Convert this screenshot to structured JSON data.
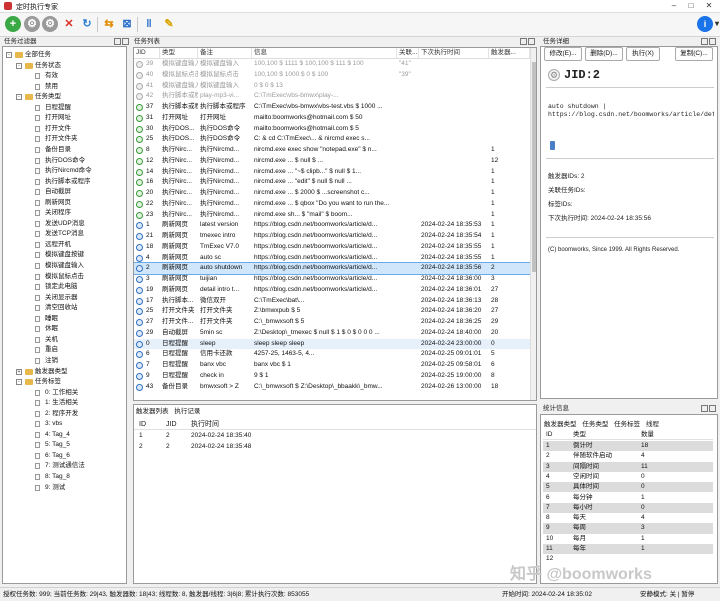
{
  "window": {
    "title": "定时执行专家"
  },
  "toolbar": {
    "buttons": [
      "add-icon",
      "gear-icon",
      "settings-icon",
      "delete-icon",
      "refresh-icon",
      "swap-icon",
      "stop-icon",
      "pause-icon",
      "tools-icon"
    ]
  },
  "tree": {
    "title": "任务过滤器",
    "items": [
      {
        "label": "全部任务",
        "level": 0,
        "type": "folder",
        "twisty": "-"
      },
      {
        "label": "任务状态",
        "level": 1,
        "type": "folder",
        "twisty": "-"
      },
      {
        "label": "有效",
        "level": 2,
        "type": "leaf"
      },
      {
        "label": "禁用",
        "level": 2,
        "type": "leaf"
      },
      {
        "label": "任务类型",
        "level": 1,
        "type": "folder",
        "twisty": "-"
      },
      {
        "label": "日程提醒",
        "level": 2,
        "type": "leaf"
      },
      {
        "label": "打开网址",
        "level": 2,
        "type": "leaf"
      },
      {
        "label": "打开文件",
        "level": 2,
        "type": "leaf"
      },
      {
        "label": "打开文件夹",
        "level": 2,
        "type": "leaf"
      },
      {
        "label": "备份目录",
        "level": 2,
        "type": "leaf"
      },
      {
        "label": "执行DOS命令",
        "level": 2,
        "type": "leaf"
      },
      {
        "label": "执行Nircmd命令",
        "level": 2,
        "type": "leaf"
      },
      {
        "label": "执行脚本或程序",
        "level": 2,
        "type": "leaf"
      },
      {
        "label": "自动截屏",
        "level": 2,
        "type": "leaf"
      },
      {
        "label": "刷新网页",
        "level": 2,
        "type": "leaf"
      },
      {
        "label": "关闭程序",
        "level": 2,
        "type": "leaf"
      },
      {
        "label": "发送UDP消息",
        "level": 2,
        "type": "leaf"
      },
      {
        "label": "发送TCP消息",
        "level": 2,
        "type": "leaf"
      },
      {
        "label": "远程开机",
        "level": 2,
        "type": "leaf"
      },
      {
        "label": "模拟键盘按键",
        "level": 2,
        "type": "leaf"
      },
      {
        "label": "模拟键盘输入",
        "level": 2,
        "type": "leaf"
      },
      {
        "label": "模拟鼠标点击",
        "level": 2,
        "type": "leaf"
      },
      {
        "label": "锁定此电脑",
        "level": 2,
        "type": "leaf"
      },
      {
        "label": "关闭显示器",
        "level": 2,
        "type": "leaf"
      },
      {
        "label": "清空回收站",
        "level": 2,
        "type": "leaf"
      },
      {
        "label": "睡眠",
        "level": 2,
        "type": "leaf"
      },
      {
        "label": "休眠",
        "level": 2,
        "type": "leaf"
      },
      {
        "label": "关机",
        "level": 2,
        "type": "leaf"
      },
      {
        "label": "重启",
        "level": 2,
        "type": "leaf"
      },
      {
        "label": "注销",
        "level": 2,
        "type": "leaf"
      },
      {
        "label": "触发器类型",
        "level": 1,
        "type": "folder",
        "twisty": "+"
      },
      {
        "label": "任务标签",
        "level": 1,
        "type": "folder",
        "twisty": "-"
      },
      {
        "label": "0: 工作相关",
        "level": 2,
        "type": "leaf"
      },
      {
        "label": "1: 生活相关",
        "level": 2,
        "type": "leaf"
      },
      {
        "label": "2: 程序开发",
        "level": 2,
        "type": "leaf"
      },
      {
        "label": "3: vbs",
        "level": 2,
        "type": "leaf"
      },
      {
        "label": "4: Tag_4",
        "level": 2,
        "type": "leaf"
      },
      {
        "label": "5: Tag_5",
        "level": 2,
        "type": "leaf"
      },
      {
        "label": "6: Tag_6",
        "level": 2,
        "type": "leaf"
      },
      {
        "label": "7: 测试通信法",
        "level": 2,
        "type": "leaf"
      },
      {
        "label": "8: Tag_8",
        "level": 2,
        "type": "leaf"
      },
      {
        "label": "9: 测试",
        "level": 2,
        "type": "leaf"
      }
    ]
  },
  "tasks": {
    "title": "任务列表",
    "columns": [
      "JID",
      "类型",
      "备注",
      "信息",
      "关联...",
      "下次执行时间",
      "触发器..."
    ],
    "rows": [
      {
        "jid": "39",
        "type": "模拟键盘输入",
        "note": "模拟键盘输入",
        "info": "100,100 $ 1111 $ 100,100 $ 111 $ 100",
        "rel": "\"41\"",
        "next": "",
        "trig": "",
        "state": "off"
      },
      {
        "jid": "40",
        "type": "模拟鼠标点击",
        "note": "模拟鼠标点击",
        "info": "100,100 $ 1000 $ 0 $ 100",
        "rel": "\"39\"",
        "next": "",
        "trig": "",
        "state": "off"
      },
      {
        "jid": "41",
        "type": "模拟键盘输入",
        "note": "模拟键盘输入",
        "info": "0 $ 0 $ 13",
        "rel": "",
        "next": "",
        "trig": "",
        "state": "off"
      },
      {
        "jid": "42",
        "type": "执行脚本或程序",
        "note": "play-mp3-vi...",
        "info": "C:\\TmExec\\vbs-bmwx\\play-...",
        "rel": "",
        "next": "",
        "trig": "",
        "state": "off"
      },
      {
        "jid": "37",
        "type": "执行脚本或程序",
        "note": "执行脚本或程序",
        "info": "C:\\TmExec\\vbs-bmwx\\vbs-test.vbs $ 1000 ...",
        "rel": "",
        "next": "",
        "trig": "",
        "state": "on"
      },
      {
        "jid": "31",
        "type": "打开网址",
        "note": "打开网址",
        "info": "mailto:boomworks@hotmail.com $ 50",
        "rel": "",
        "next": "",
        "trig": "",
        "state": "on"
      },
      {
        "jid": "30",
        "type": "执行DOS...",
        "note": "执行DOS命令",
        "info": "mailto:boomworks@hotmail.com $ 5",
        "rel": "",
        "next": "",
        "trig": "",
        "state": "on"
      },
      {
        "jid": "25",
        "type": "执行DOS...",
        "note": "执行DOS命令",
        "info": "C: & cd C:\\TmExec\\... & nircmd exec s...",
        "rel": "",
        "next": "",
        "trig": "",
        "state": "on"
      },
      {
        "jid": "8",
        "type": "执行Nirc...",
        "note": "执行Nircmd...",
        "info": "nircmd.exe exec show \"notepad.exe\" $ n...",
        "rel": "",
        "next": "",
        "trig": "1",
        "state": "on"
      },
      {
        "jid": "12",
        "type": "执行Nirc...",
        "note": "执行Nircmd...",
        "info": "nircmd.exe ... $ null $ ...",
        "rel": "",
        "next": "",
        "trig": "12",
        "state": "on"
      },
      {
        "jid": "14",
        "type": "执行Nirc...",
        "note": "执行Nircmd...",
        "info": "nircmd.exe ... \"~$ clipb...\" $ null $ 1...",
        "rel": "",
        "next": "",
        "trig": "1",
        "state": "on"
      },
      {
        "jid": "16",
        "type": "执行Nirc...",
        "note": "执行Nircmd...",
        "info": "nircmd.exe ... \"edit\" $ null $ null ...",
        "rel": "",
        "next": "",
        "trig": "1",
        "state": "on"
      },
      {
        "jid": "20",
        "type": "执行Nirc...",
        "note": "执行Nircmd...",
        "info": "nircmd.exe ... $ 2000 $ ...screenshot c...",
        "rel": "",
        "next": "",
        "trig": "1",
        "state": "on"
      },
      {
        "jid": "22",
        "type": "执行Nirc...",
        "note": "执行Nircmd...",
        "info": "nircmd.exe ... $ qbox \"Do you want to run the...",
        "rel": "",
        "next": "",
        "trig": "1",
        "state": "on"
      },
      {
        "jid": "23",
        "type": "执行Nirc...",
        "note": "执行Nircmd...",
        "info": "nircmd.exe sh... $ \"mail\" $ boom...",
        "rel": "",
        "next": "",
        "trig": "1",
        "state": "on"
      },
      {
        "jid": "1",
        "type": "刷新网页",
        "note": "latest version",
        "info": "https://blog.csdn.net/boomworks/article/d...",
        "rel": "",
        "next": "2024-02-24 18:35:53",
        "trig": "1",
        "state": "clk"
      },
      {
        "jid": "21",
        "type": "刷新网页",
        "note": "tmexec intro",
        "info": "https://blog.csdn.net/boomworks/article/d...",
        "rel": "",
        "next": "2024-02-24 18:35:54",
        "trig": "1",
        "state": "clk"
      },
      {
        "jid": "18",
        "type": "刷新网页",
        "note": "TmExec V7.0",
        "info": "https://blog.csdn.net/boomworks/article/d...",
        "rel": "",
        "next": "2024-02-24 18:35:55",
        "trig": "1",
        "state": "clk"
      },
      {
        "jid": "4",
        "type": "刷新网页",
        "note": "auto sc",
        "info": "https://blog.csdn.net/boomworks/article/d...",
        "rel": "",
        "next": "2024-02-24 18:35:55",
        "trig": "1",
        "state": "clk"
      },
      {
        "jid": "2",
        "type": "刷新网页",
        "note": "auto shutdown",
        "info": "https://blog.csdn.net/boomworks/article/d...",
        "rel": "",
        "next": "2024-02-24 18:35:56",
        "trig": "2",
        "state": "clk",
        "selected": true
      },
      {
        "jid": "3",
        "type": "刷新网页",
        "note": "tuijian",
        "info": "https://blog.csdn.net/boomworks/article/d...",
        "rel": "",
        "next": "2024-02-24 18:36:00",
        "trig": "3",
        "state": "clk"
      },
      {
        "jid": "19",
        "type": "刷新网页",
        "note": "detail intro t...",
        "info": "https://blog.csdn.net/boomworks/article/d...",
        "rel": "",
        "next": "2024-02-24 18:36:01",
        "trig": "27",
        "state": "clk"
      },
      {
        "jid": "17",
        "type": "执行脚本...",
        "note": "微信双开",
        "info": "C:\\TmExec\\bat\\...",
        "rel": "",
        "next": "2024-02-24 18:36:13",
        "trig": "28",
        "state": "clk"
      },
      {
        "jid": "25",
        "type": "打开文件夹",
        "note": "打开文件夹",
        "info": "Z:\\bmwxpub $ 5",
        "rel": "",
        "next": "2024-02-24 18:36:20",
        "trig": "27",
        "state": "clk"
      },
      {
        "jid": "27",
        "type": "打开文件...",
        "note": "打开文件夹",
        "info": "C:\\_bmwxsoft $ 5",
        "rel": "",
        "next": "2024-02-24 18:36:25",
        "trig": "29",
        "state": "clk"
      },
      {
        "jid": "29",
        "type": "自动截屏",
        "note": "5min sc",
        "info": "Z:\\Desktop\\_tmexec $ null $ 1 $ 0 $ 0 0 0 ...",
        "rel": "",
        "next": "2024-02-24 18:40:00",
        "trig": "20",
        "state": "clk"
      },
      {
        "jid": "0",
        "type": "日程提醒",
        "note": "sleep",
        "info": "sleep sleep sleep",
        "rel": "",
        "next": "2024-02-24 23:00:00",
        "trig": "0",
        "state": "clk",
        "hover": true
      },
      {
        "jid": "6",
        "type": "日程提醒",
        "note": "信用卡还款",
        "info": "4257-25, 1463-5, 4...",
        "rel": "",
        "next": "2024-02-25 09:01:01",
        "trig": "5",
        "state": "clk"
      },
      {
        "jid": "7",
        "type": "日程提醒",
        "note": "banx vbc",
        "info": "banx vbc $ 1",
        "rel": "",
        "next": "2024-02-25 09:58:01",
        "trig": "6",
        "state": "clk"
      },
      {
        "jid": "9",
        "type": "日程提醒",
        "note": "check in",
        "info": "9 $ 1",
        "rel": "",
        "next": "2024-02-25 19:00:00",
        "trig": "8",
        "state": "clk"
      },
      {
        "jid": "43",
        "type": "备份目录",
        "note": "bmwxsoft > Z",
        "info": "C:\\_bmwxsoft $ Z:\\Desktop\\_bbaakk\\_bmw...",
        "rel": "",
        "next": "2024-02-26 13:00:00",
        "trig": "18",
        "state": "clk"
      }
    ]
  },
  "trigger_log": {
    "tabs": [
      "触发器列表",
      "执行记录"
    ],
    "columns": [
      "ID",
      "JID",
      "执行时间"
    ],
    "rows": [
      {
        "id": "1",
        "jid": "2",
        "time": "2024-02-24 18:35:40"
      },
      {
        "id": "2",
        "jid": "2",
        "time": "2024-02-24 18:35:48"
      }
    ]
  },
  "detail": {
    "title": "任务详细",
    "buttons": [
      "修改(E)...",
      "删除(D)...",
      "执行(X)",
      "复制(C)..."
    ],
    "jid_label": "JID:2",
    "body_lines": [
      "auto shutdown |",
      "https://blog.csdn.net/boomworks/article/detail"
    ],
    "props": [
      "触发器IDs: 2",
      "关联任务IDs:",
      "标签IDs:",
      "下次执行时间: 2024-02-24 18:35:56"
    ],
    "copyright": "(C) boomworks, Since 1999. All Rights Reserved."
  },
  "stats": {
    "title": "统计信息",
    "tabs": [
      "触发器类型",
      "任务类型",
      "任务标签",
      "线程"
    ],
    "columns": [
      "ID",
      "类型",
      "数量"
    ],
    "rows": [
      {
        "id": "1",
        "type": "倒计时",
        "count": "18"
      },
      {
        "id": "2",
        "type": "伴随软件启动",
        "count": "4"
      },
      {
        "id": "3",
        "type": "间隔时间",
        "count": "11"
      },
      {
        "id": "4",
        "type": "空闲时间",
        "count": "0"
      },
      {
        "id": "5",
        "type": "具体时间",
        "count": "0"
      },
      {
        "id": "6",
        "type": "每分钟",
        "count": "1"
      },
      {
        "id": "7",
        "type": "每小时",
        "count": "0"
      },
      {
        "id": "8",
        "type": "每天",
        "count": "4"
      },
      {
        "id": "9",
        "type": "每周",
        "count": "3"
      },
      {
        "id": "10",
        "type": "每月",
        "count": "1"
      },
      {
        "id": "11",
        "type": "每年",
        "count": "1"
      },
      {
        "id": "12",
        "type": "",
        "count": ""
      }
    ]
  },
  "status": {
    "left": "授权任务数: 999; 当前任务数: 29|43, 触发器数: 18|43; 线程数: 8, 触发器/线程: 3|6|8; 累计执行次数: 853055",
    "right_time": "开始时间: 2024-02-24 18:35:02",
    "right_mode": "安静模式: 关 | 暂停"
  },
  "watermark": "知乎 @boomworks"
}
